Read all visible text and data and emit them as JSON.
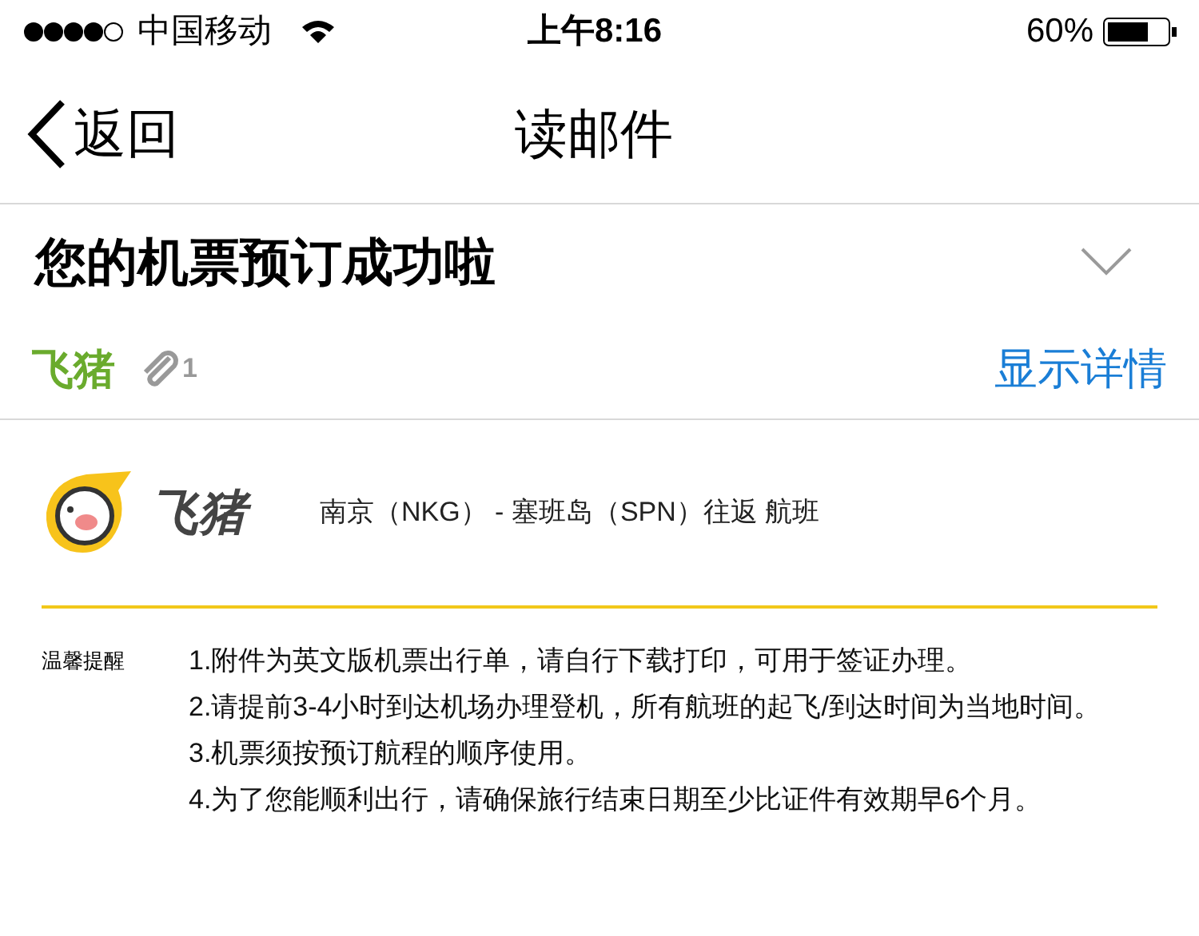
{
  "status_bar": {
    "carrier": "中国移动",
    "time": "上午8:16",
    "battery": "60%"
  },
  "nav": {
    "back": "返回",
    "title": "读邮件"
  },
  "mail": {
    "subject": "您的机票预订成功啦",
    "sender": "飞猪",
    "attachments": "1",
    "details": "显示详情",
    "expanded": false
  },
  "body": {
    "brand": "飞猪",
    "route": "南京（NKG） - 塞班岛（SPN）往返 航班",
    "notice_label": "温馨提醒",
    "notices": [
      "1.附件为英文版机票出行单，请自行下载打印，可用于签证办理。",
      "2.请提前3-4小时到达机场办理登机，所有航班的起飞/到达时间为当地时间。",
      "3.机票须按预订航程的顺序使用。",
      "4.为了您能顺利出行，请确保旅行结束日期至少比证件有效期早6个月。"
    ]
  }
}
